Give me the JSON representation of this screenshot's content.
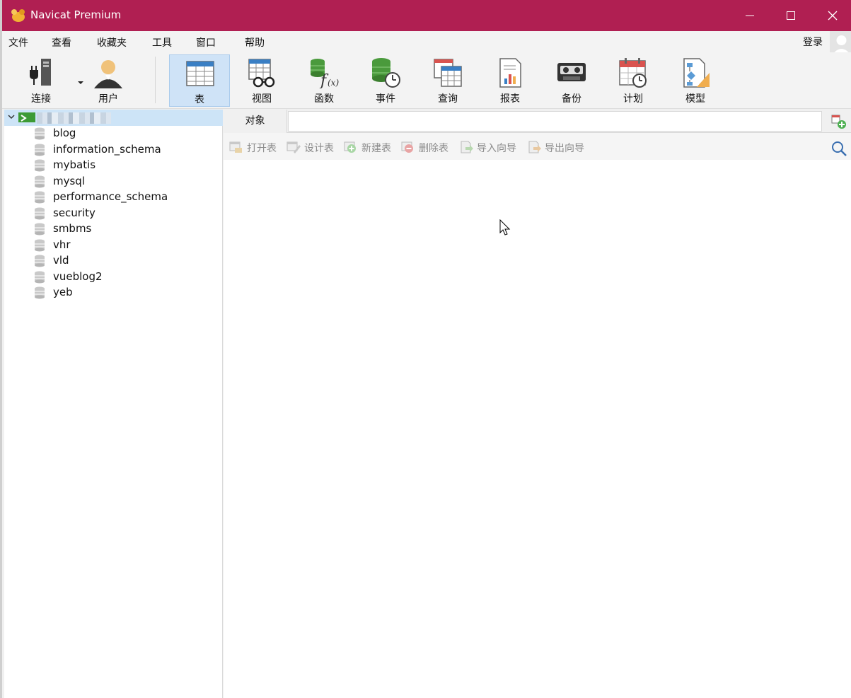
{
  "window": {
    "title": "Navicat Premium"
  },
  "menu": {
    "items": [
      "文件",
      "查看",
      "收藏夹",
      "工具",
      "窗口",
      "帮助"
    ],
    "login": "登录"
  },
  "toolbar": {
    "tools": [
      {
        "label": "连接",
        "icon": "plug-icon"
      },
      {
        "label": "用户",
        "icon": "user-icon"
      },
      {
        "label": "表",
        "icon": "table-icon",
        "active": true
      },
      {
        "label": "视图",
        "icon": "view-icon"
      },
      {
        "label": "函数",
        "icon": "function-icon"
      },
      {
        "label": "事件",
        "icon": "event-icon"
      },
      {
        "label": "查询",
        "icon": "query-icon"
      },
      {
        "label": "报表",
        "icon": "report-icon"
      },
      {
        "label": "备份",
        "icon": "backup-icon"
      },
      {
        "label": "计划",
        "icon": "schedule-icon"
      },
      {
        "label": "模型",
        "icon": "model-icon"
      }
    ]
  },
  "tree": {
    "databases": [
      "blog",
      "information_schema",
      "mybatis",
      "mysql",
      "performance_schema",
      "security",
      "smbms",
      "vhr",
      "vld",
      "vueblog2",
      "yeb"
    ]
  },
  "main": {
    "tab_label": "对象",
    "object_actions": [
      "打开表",
      "设计表",
      "新建表",
      "删除表",
      "导入向导",
      "导出向导"
    ]
  },
  "colors": {
    "titlebar": "#b01f52",
    "active_tool": "#cfe3f7",
    "tree_selection": "#cde4f7"
  }
}
